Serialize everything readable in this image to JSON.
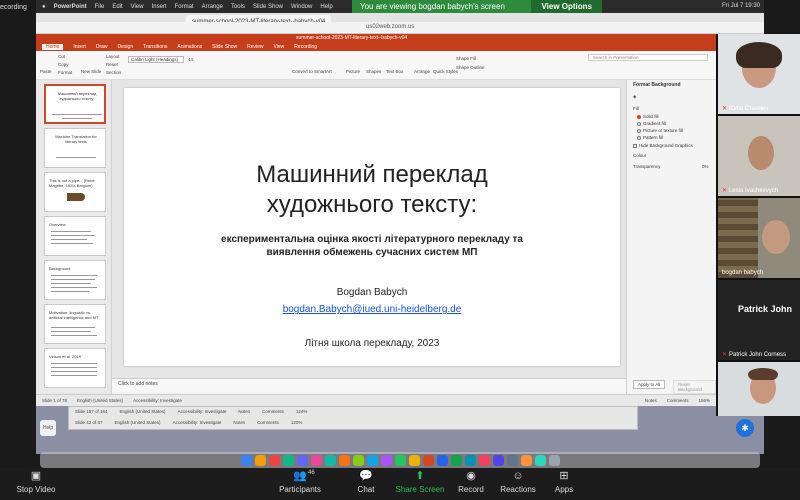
{
  "recording_label": "ecording",
  "banner": {
    "message": "You are viewing bogdan babych's screen",
    "view_options": "View Options"
  },
  "menubar": {
    "items": [
      "PowerPoint",
      "File",
      "Edit",
      "View",
      "Insert",
      "Format",
      "Arrange",
      "Tools",
      "Slide Show",
      "Window",
      "Help"
    ],
    "clock": "Fri Jul 7 19:30"
  },
  "browser": {
    "tab1": "summer-school-2023-MT-literary-text--babych-v04",
    "url": "us02web.zoom.us"
  },
  "ppt": {
    "window_title": "summer-school-2023-MT-literary-text--babych-v04",
    "tabs": [
      "Home",
      "Insert",
      "Draw",
      "Design",
      "Transitions",
      "Animations",
      "Slide Show",
      "Review",
      "View",
      "Recording"
    ],
    "active_tab": "Home",
    "ribbon": {
      "paste": "Paste",
      "cut": "Cut",
      "copy": "Copy",
      "format": "Format",
      "new_slide": "New Slide",
      "layout": "Layout",
      "reset": "Reset",
      "section": "Section",
      "font": "Calibri Light (Headings)",
      "font_size": "44",
      "convert": "Convert to SmartArt",
      "picture": "Picture",
      "shapes": "Shapes",
      "text_box": "Text Box",
      "arrange": "Arrange",
      "quick_styles": "Quick Styles",
      "shape_fill": "Shape Fill",
      "shape_outline": "Shape Outline",
      "search": "Search in Presentation"
    },
    "thumbs": [
      {
        "title": "Машинний переклад художнього тексту:",
        "selected": true
      },
      {
        "title": "Machine Translation for literary texts",
        "selected": false
      },
      {
        "title": "This is not a pipe... (René Magritte, 1929, Belgium)",
        "selected": false
      },
      {
        "title": "Overview",
        "selected": false
      },
      {
        "title": "Background",
        "selected": false
      },
      {
        "title": "Motivation: linguistic vs. artificial intelligence and MT",
        "selected": false
      },
      {
        "title": "Vinson et al. 2019",
        "selected": false
      }
    ],
    "slide": {
      "title_line1": "Машинний переклад",
      "title_line2": "художнього тексту:",
      "subtitle_line1": "експериментальна оцінка якості літературного перекладу та",
      "subtitle_line2": "виявлення обмежень сучасних систем МП",
      "author": "Bogdan Babych",
      "email": "bogdan.Babych@iued.uni-heidelberg.de",
      "school": "Літня школа перекладу, 2023"
    },
    "notes_placeholder": "Click to add notes",
    "format_pane": {
      "heading": "Format Background",
      "fill_label": "Fill",
      "options": [
        "Solid fill",
        "Gradient fill",
        "Picture or texture fill",
        "Pattern fill"
      ],
      "hide_graphics": "Hide Background Graphics",
      "color_label": "Colour",
      "transparency_label": "Transparency",
      "transparency_value": "0%",
      "apply_all": "Apply to All",
      "reset": "Reset Background"
    },
    "status": {
      "slide_of": "Slide 1 of 78",
      "language": "English (United States)",
      "accessibility": "Accessibility: Investigate",
      "notes": "Notes",
      "comments": "Comments",
      "zoom": "156%"
    }
  },
  "ppt2": {
    "row1": [
      "Slide 157 of 164",
      "English (United States)",
      "Accessibility: Investigate",
      "Notes",
      "Comments",
      "124%"
    ],
    "row2": [
      "Slide 42 of 57",
      "English (United States)",
      "Accessibility: Investigate",
      "Notes",
      "Comments",
      "120%"
    ]
  },
  "help_label": "Help",
  "participants": [
    {
      "name": "Юлія Стахмич",
      "muted": true
    },
    {
      "name": "Lesia Ivashkevych",
      "muted": true
    },
    {
      "name": "bogdan babych",
      "muted": false
    },
    {
      "name": "Patrick John Corness",
      "big": "Patrick John",
      "muted": true
    },
    {
      "name": "",
      "muted": false
    }
  ],
  "toolbar": {
    "stop_video": "Stop Video",
    "participants": "Participants",
    "participants_count": "46",
    "chat": "Chat",
    "share_screen": "Share Screen",
    "record": "Record",
    "reactions": "Reactions",
    "apps": "Apps"
  }
}
